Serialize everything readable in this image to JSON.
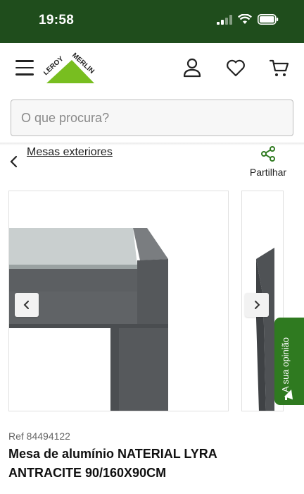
{
  "status_bar": {
    "time": "19:58"
  },
  "header": {
    "brand": {
      "word1": "LEROY",
      "word2": "MERLIN",
      "color": "#78be20"
    },
    "icons": [
      "menu-icon",
      "account-icon",
      "heart-icon",
      "cart-icon"
    ]
  },
  "search": {
    "placeholder": "O que procura?"
  },
  "breadcrumb": {
    "label": "Mesas exteriores"
  },
  "share": {
    "label": "Partilhar"
  },
  "feedback": {
    "label": "A sua opinião"
  },
  "product": {
    "ref": "Ref 84494122",
    "title": "Mesa de alumínio NATERIAL LYRA ANTRACITE 90/160X90CM"
  },
  "colors": {
    "status_bar": "#1f4d1c",
    "accent": "#2f7a20",
    "logo_green": "#78be20"
  }
}
